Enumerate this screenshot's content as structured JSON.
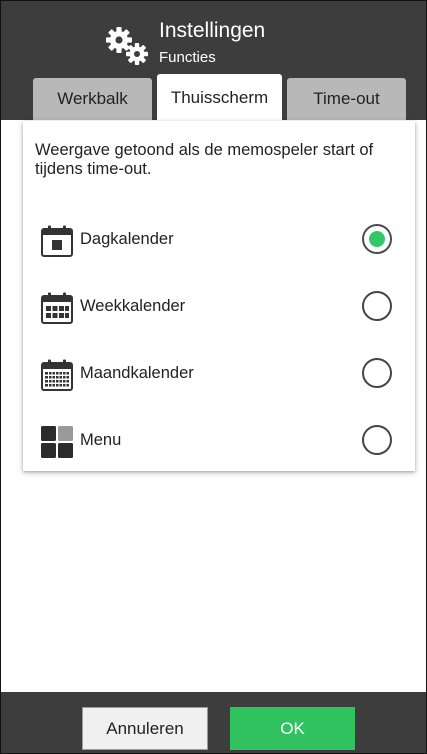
{
  "header": {
    "title": "Instellingen",
    "subtitle": "Functies",
    "icon": "gears-icon"
  },
  "tabs": [
    {
      "label": "Werkbalk",
      "active": false
    },
    {
      "label": "Thuisscherm",
      "active": true
    },
    {
      "label": "Time-out",
      "active": false
    }
  ],
  "card": {
    "description": "Weergave getoond als de memospeler start of tijdens time-out.",
    "options": [
      {
        "label": "Dagkalender",
        "icon": "day-calendar-icon",
        "selected": true
      },
      {
        "label": "Weekkalender",
        "icon": "week-calendar-icon",
        "selected": false
      },
      {
        "label": "Maandkalender",
        "icon": "month-calendar-icon",
        "selected": false
      },
      {
        "label": "Menu",
        "icon": "menu-grid-icon",
        "selected": false
      }
    ]
  },
  "footer": {
    "cancel_label": "Annuleren",
    "ok_label": "OK"
  },
  "colors": {
    "header_bg": "#3d3d3d",
    "tab_inactive": "#b8b8b8",
    "accent_green": "#2fc25e",
    "radio_selected": "#33c76a"
  }
}
